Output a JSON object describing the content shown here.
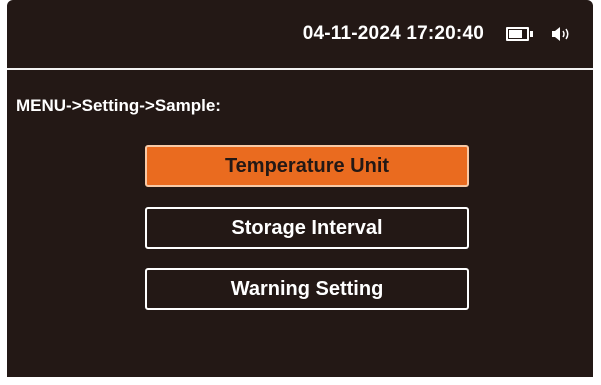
{
  "status_bar": {
    "datetime": "04-11-2024 17:20:40",
    "battery_level": 0.75,
    "battery_icon": "battery-icon",
    "speaker_icon": "speaker-icon"
  },
  "breadcrumb": "MENU->Setting->Sample:",
  "menu": {
    "items": [
      {
        "label": "Temperature Unit",
        "selected": true
      },
      {
        "label": "Storage Interval",
        "selected": false
      },
      {
        "label": "Warning Setting",
        "selected": false
      }
    ]
  },
  "colors": {
    "background": "#231815",
    "accent": "#ea6b1f",
    "text": "#ffffff"
  }
}
